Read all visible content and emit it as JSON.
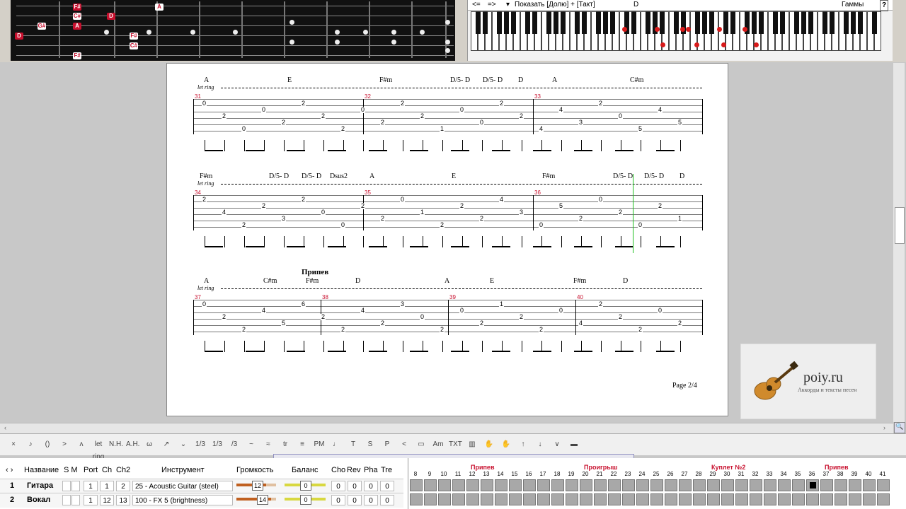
{
  "fretboard": {
    "notes": [
      {
        "label": "F#",
        "style": "red"
      },
      {
        "label": "C#",
        "style": "white"
      },
      {
        "label": "D",
        "style": "red"
      },
      {
        "label": "A",
        "style": "red"
      },
      {
        "label": "A",
        "style": "white"
      },
      {
        "label": "G#",
        "style": "white"
      },
      {
        "label": "D",
        "style": "red"
      },
      {
        "label": "F#",
        "style": "white"
      },
      {
        "label": "C#",
        "style": "white"
      },
      {
        "label": "F#",
        "style": "white"
      }
    ]
  },
  "piano": {
    "nav_left": "<=",
    "nav_right": "=>",
    "show_label": "Показать [Долю] + [Такт]",
    "current_chord": "D",
    "scales_label": "Гаммы",
    "help_label": "?"
  },
  "score": {
    "systems": [
      {
        "chords": [
          "A",
          "E",
          "F#m",
          "D/5- D",
          "D/5- D",
          "D",
          "A",
          "C#m"
        ],
        "let_ring": "let ring",
        "measures": [
          "31",
          "32",
          "33"
        ],
        "tabs": [
          {
            "t": "0"
          },
          {
            "t": "2"
          },
          {
            "t": "0"
          },
          {
            "t": "0"
          },
          {
            "t": "2"
          },
          {
            "t": "2"
          },
          {
            "t": "2"
          },
          {
            "t": "2"
          },
          {
            "t": "0"
          },
          {
            "t": "2"
          },
          {
            "t": "2"
          },
          {
            "t": "2"
          },
          {
            "t": "1"
          },
          {
            "t": "0"
          },
          {
            "t": "0"
          },
          {
            "t": "2"
          },
          {
            "t": "2"
          },
          {
            "t": "4"
          },
          {
            "t": "4"
          },
          {
            "t": "3"
          },
          {
            "t": "2"
          },
          {
            "t": "0"
          },
          {
            "t": "5"
          },
          {
            "t": "4"
          },
          {
            "t": "5"
          }
        ]
      },
      {
        "chords": [
          "F#m",
          "D/5- D",
          "D/5- D",
          "Dsus2",
          "A",
          "E",
          "F#m",
          "D/5- D",
          "D/5- D",
          "D"
        ],
        "let_ring": "let ring",
        "measures": [
          "34",
          "35",
          "36"
        ],
        "tabs": [
          {
            "t": "2"
          },
          {
            "t": "4"
          },
          {
            "t": "2"
          },
          {
            "t": "2"
          },
          {
            "t": "3"
          },
          {
            "t": "2"
          },
          {
            "t": "0"
          },
          {
            "t": "0"
          },
          {
            "t": "2"
          },
          {
            "t": "2"
          },
          {
            "t": "0"
          },
          {
            "t": "1"
          },
          {
            "t": "2"
          },
          {
            "t": "2"
          },
          {
            "t": "2"
          },
          {
            "t": "4"
          },
          {
            "t": "3"
          },
          {
            "t": "0"
          },
          {
            "t": "5"
          },
          {
            "t": "2"
          },
          {
            "t": "0"
          },
          {
            "t": "2"
          },
          {
            "t": "0"
          },
          {
            "t": "2"
          },
          {
            "t": "1"
          }
        ]
      },
      {
        "section": "Припев",
        "chords": [
          "A",
          "C#m",
          "F#m",
          "D",
          "A",
          "E",
          "F#m",
          "D"
        ],
        "let_ring": "let ring",
        "measures": [
          "37",
          "38",
          "39",
          "40"
        ],
        "tabs": [
          {
            "t": "0"
          },
          {
            "t": "2"
          },
          {
            "t": "2"
          },
          {
            "t": "4"
          },
          {
            "t": "5"
          },
          {
            "t": "6"
          },
          {
            "t": "2"
          },
          {
            "t": "2"
          },
          {
            "t": "4"
          },
          {
            "t": "2"
          },
          {
            "t": "3"
          },
          {
            "t": "0"
          },
          {
            "t": "2"
          },
          {
            "t": "0"
          },
          {
            "t": "2"
          },
          {
            "t": "1"
          },
          {
            "t": "2"
          },
          {
            "t": "2"
          },
          {
            "t": "0"
          },
          {
            "t": "4"
          },
          {
            "t": "2"
          },
          {
            "t": "2"
          },
          {
            "t": "2"
          },
          {
            "t": "0"
          },
          {
            "t": "2"
          }
        ]
      }
    ],
    "page_number": "Page 2/4"
  },
  "logo": {
    "name": "poiy.ru",
    "subtitle": "Аккорды и тексты песен"
  },
  "toolbar": {
    "items": [
      {
        "label": "×",
        "icon": "dead-note-icon"
      },
      {
        "label": "♪",
        "icon": "ghost-note-icon"
      },
      {
        "label": "()",
        "icon": "parentheses-icon"
      },
      {
        "label": ">",
        "icon": "accent-icon"
      },
      {
        "label": "ʌ",
        "icon": "heavy-accent-icon"
      },
      {
        "label": "let ring",
        "icon": "let-ring-icon"
      },
      {
        "label": "N.H.",
        "icon": "natural-harmonic-icon"
      },
      {
        "label": "A.H.",
        "icon": "artificial-harmonic-icon"
      },
      {
        "label": "ω",
        "icon": "hammer-on-icon"
      },
      {
        "label": "↗",
        "icon": "slide-icon"
      },
      {
        "label": "⌄",
        "icon": "bend-icon"
      },
      {
        "label": "1/3",
        "icon": "triplet-icon"
      },
      {
        "label": "1/3",
        "icon": "tuplet-icon"
      },
      {
        "label": "/3",
        "icon": "slash-tuplet-icon"
      },
      {
        "label": "~",
        "icon": "vibrato-icon"
      },
      {
        "label": "≈",
        "icon": "wide-vibrato-icon"
      },
      {
        "label": "tr",
        "icon": "trill-icon"
      },
      {
        "label": "≡",
        "icon": "tremolo-icon"
      },
      {
        "label": "PM",
        "icon": "palm-mute-icon"
      },
      {
        "label": "♩",
        "icon": "staccato-icon"
      },
      {
        "label": "T",
        "icon": "tapping-icon"
      },
      {
        "label": "S",
        "icon": "slap-icon"
      },
      {
        "label": "P",
        "icon": "pop-icon"
      },
      {
        "label": "<",
        "icon": "crescendo-icon"
      },
      {
        "label": "▭",
        "icon": "fade-icon"
      },
      {
        "label": "Am",
        "icon": "chord-icon"
      },
      {
        "label": "TXT",
        "icon": "text-icon"
      },
      {
        "label": "▥",
        "icon": "marker-icon"
      },
      {
        "label": "✋",
        "icon": "stroke-down-icon"
      },
      {
        "label": "✋",
        "icon": "stroke-up-icon"
      },
      {
        "label": "↑",
        "icon": "arrow-up-icon"
      },
      {
        "label": "↓",
        "icon": "arrow-down-icon"
      },
      {
        "label": "∨",
        "icon": "pickstroke-down-icon"
      },
      {
        "label": "▬",
        "icon": "pickstroke-up-icon"
      }
    ]
  },
  "tracks": {
    "header": {
      "name": "Название",
      "sm": "S M",
      "port": "Port",
      "ch": "Ch",
      "ch2": "Ch2",
      "instrument": "Инструмент",
      "volume": "Громкость",
      "balance": "Баланс",
      "cho": "Cho",
      "rev": "Rev",
      "pha": "Pha",
      "tre": "Tre"
    },
    "rows": [
      {
        "num": "1",
        "name": "Гитара",
        "port": "1",
        "ch": "1",
        "ch2": "2",
        "instrument": "25 - Acoustic Guitar (steel)",
        "volume": "12",
        "volume_fraction": 0.75,
        "balance": "0",
        "cho": "0",
        "rev": "0",
        "pha": "0",
        "tre": "0"
      },
      {
        "num": "2",
        "name": "Вокал",
        "port": "1",
        "ch": "12",
        "ch2": "13",
        "instrument": "100 - FX 5 (brightness)",
        "volume": "14",
        "volume_fraction": 0.88,
        "balance": "0",
        "cho": "0",
        "rev": "0",
        "pha": "0",
        "tre": "0"
      }
    ]
  },
  "timeline": {
    "markers": [
      {
        "label": "Припев",
        "at": "12"
      },
      {
        "label": "Проигрыш",
        "at": "20"
      },
      {
        "label": "Куплет №2",
        "at": "29"
      },
      {
        "label": "Припев",
        "at": "37"
      }
    ],
    "numbers": [
      "8",
      "9",
      "10",
      "11",
      "12",
      "13",
      "14",
      "15",
      "16",
      "17",
      "18",
      "19",
      "20",
      "21",
      "22",
      "23",
      "24",
      "25",
      "26",
      "27",
      "28",
      "29",
      "30",
      "31",
      "32",
      "33",
      "34",
      "35",
      "36",
      "37",
      "38",
      "39",
      "40",
      "41"
    ],
    "current_measure": "36"
  },
  "colors": {
    "accent_red": "#c8102e",
    "marker_red": "#c8102e"
  }
}
